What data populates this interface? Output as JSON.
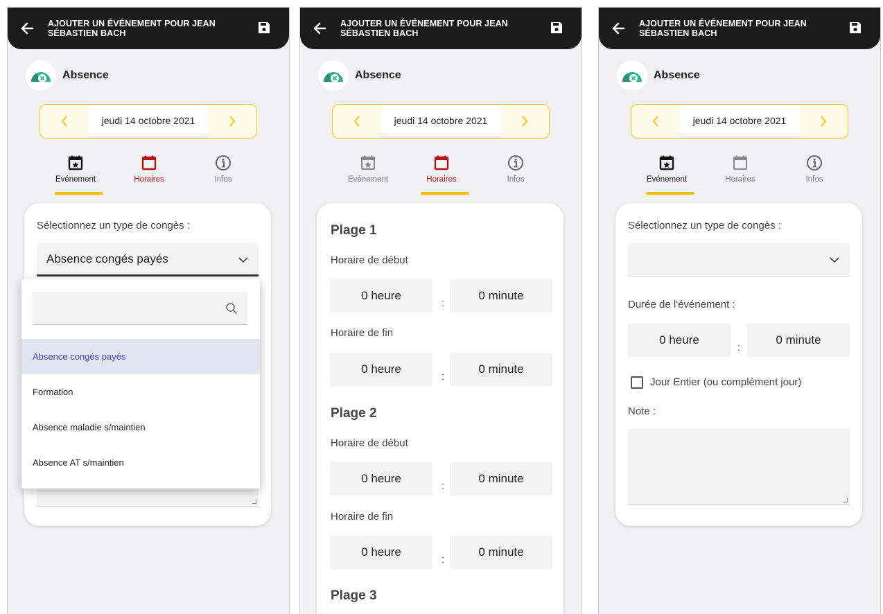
{
  "colors": {
    "accent_yellow": "#f5c518",
    "topbar": "#1b1b1b",
    "active_red": "#b3141c",
    "selected_blue": "#3948a3",
    "background": "#f1f1f3"
  },
  "app": {
    "title": "AJOUTER UN ÉVÉNEMENT POUR JEAN SÉBASTIEN BACH",
    "back_icon": "arrow-left-icon",
    "save_icon": "floppy-disk-icon"
  },
  "header": {
    "absence_label": "Absence",
    "avatar_icon": "absence-badge-icon"
  },
  "datepicker": {
    "date": "jeudi 14 octobre 2021"
  },
  "tabs": {
    "event": "Evénement",
    "schedule": "Horaires",
    "info": "Infos"
  },
  "screen1": {
    "type_label": "Sélectionnez un type de congès :",
    "type_value": "Absence congés payés",
    "dropdown": {
      "search_placeholder": "",
      "options": [
        "Absence congés payés",
        "Formation",
        "Absence maladie s/maintien",
        "Absence AT s/maintien"
      ]
    }
  },
  "screen2": {
    "plages": [
      {
        "title": "Plage 1",
        "start_label": "Horaire de début",
        "start_hour": "0 heure",
        "start_minute": "0 minute",
        "end_label": "Horaire de fin",
        "end_hour": "0 heure",
        "end_minute": "0 minute"
      },
      {
        "title": "Plage 2",
        "start_label": "Horaire de début",
        "start_hour": "0 heure",
        "start_minute": "0 minute",
        "end_label": "Horaire de fin",
        "end_hour": "0 heure",
        "end_minute": "0 minute"
      },
      {
        "title": "Plage 3"
      }
    ],
    "colon": ":"
  },
  "screen3": {
    "type_label": "Sélectionnez un type de congès :",
    "type_value": "",
    "duration_label": "Durée de l'événement :",
    "hour": "0 heure",
    "minute": "0 minute",
    "colon": ":",
    "full_day_label": "Jour Entier (ou complément jour)",
    "full_day_checked": false,
    "note_label": "Note :",
    "note_value": ""
  }
}
